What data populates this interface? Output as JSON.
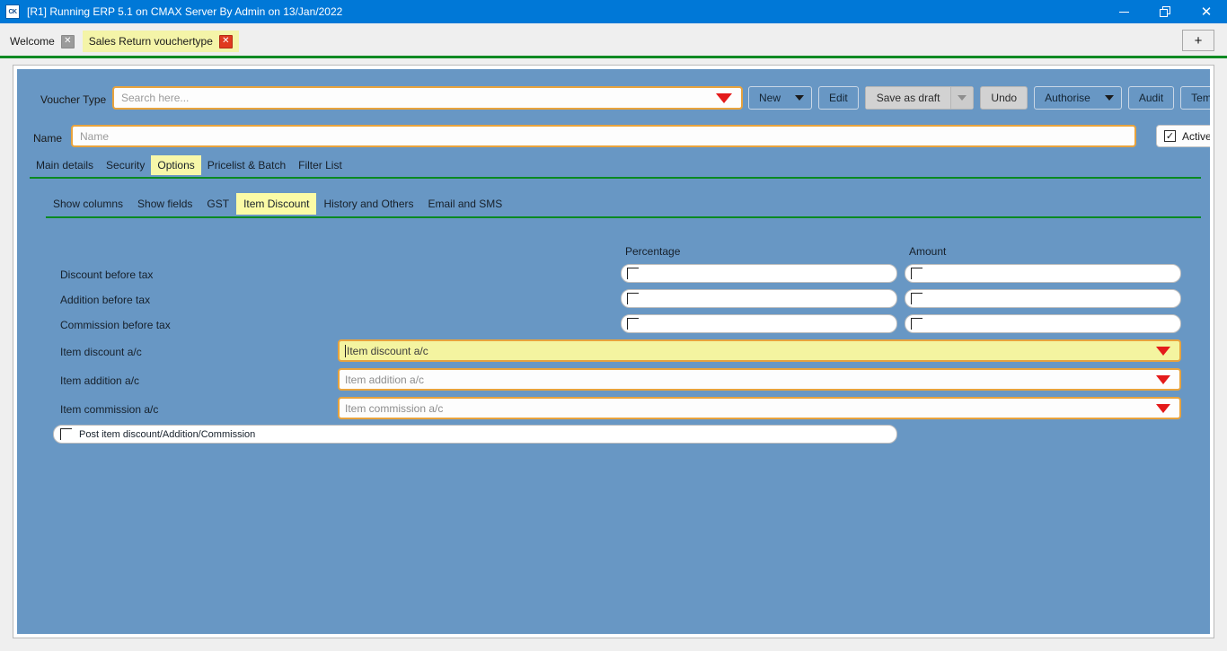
{
  "window": {
    "title": "[R1] Running ERP 5.1 on CMAX Server By Admin on 13/Jan/2022",
    "app_icon_text": "CK",
    "minimize_label": "–",
    "restore_label": "❐",
    "close_label": "✕"
  },
  "tabstrip": {
    "tabs": [
      {
        "label": "Welcome",
        "active": false,
        "close": "✕"
      },
      {
        "label": "Sales Return vouchertype",
        "active": true,
        "close": "✕"
      }
    ],
    "new_tab_label": "+"
  },
  "form_header": {
    "voucher_type_label": "Voucher Type",
    "voucher_type_placeholder": "Search here...",
    "name_label": "Name",
    "name_placeholder": "Name",
    "active_label": "Active",
    "active_checked": "✓"
  },
  "toolbar": {
    "new_label": "New",
    "edit_label": "Edit",
    "save_as_draft_label": "Save as draft",
    "undo_label": "Undo",
    "authorise_label": "Authorise",
    "audit_label": "Audit",
    "template_label": "Template"
  },
  "main_tabs": [
    {
      "label": "Main details",
      "active": false
    },
    {
      "label": "Security",
      "active": false
    },
    {
      "label": "Options",
      "active": true
    },
    {
      "label": "Pricelist & Batch",
      "active": false
    },
    {
      "label": "Filter List",
      "active": false
    }
  ],
  "sub_tabs": [
    {
      "label": "Show columns",
      "active": false
    },
    {
      "label": "Show fields",
      "active": false
    },
    {
      "label": "GST",
      "active": false
    },
    {
      "label": "Item Discount",
      "active": true
    },
    {
      "label": "History and Others",
      "active": false
    },
    {
      "label": "Email and SMS",
      "active": false
    }
  ],
  "item_discount": {
    "col_percentage": "Percentage",
    "col_amount": "Amount",
    "checkbox_rows": [
      {
        "label": "Discount before tax",
        "percentage_checked": false,
        "amount_checked": false
      },
      {
        "label": "Addition before tax",
        "percentage_checked": false,
        "amount_checked": false
      },
      {
        "label": "Commission before tax",
        "percentage_checked": false,
        "amount_checked": false
      }
    ],
    "account_rows": [
      {
        "label": "Item discount a/c",
        "placeholder": "Item discount a/c",
        "focused": true
      },
      {
        "label": "Item addition a/c",
        "placeholder": "Item addition a/c",
        "focused": false
      },
      {
        "label": "Item commission a/c",
        "placeholder": "Item commission a/c",
        "focused": false
      }
    ],
    "post_label": "Post item discount/Addition/Commission",
    "post_checked": false
  },
  "colors": {
    "titlebar": "#0078d7",
    "panel": "#6897c4",
    "highlight": "#f4f4a8",
    "accent_border": "#e8a33d",
    "rule_green": "#0a8a22",
    "caret_red": "#e41a1a"
  }
}
